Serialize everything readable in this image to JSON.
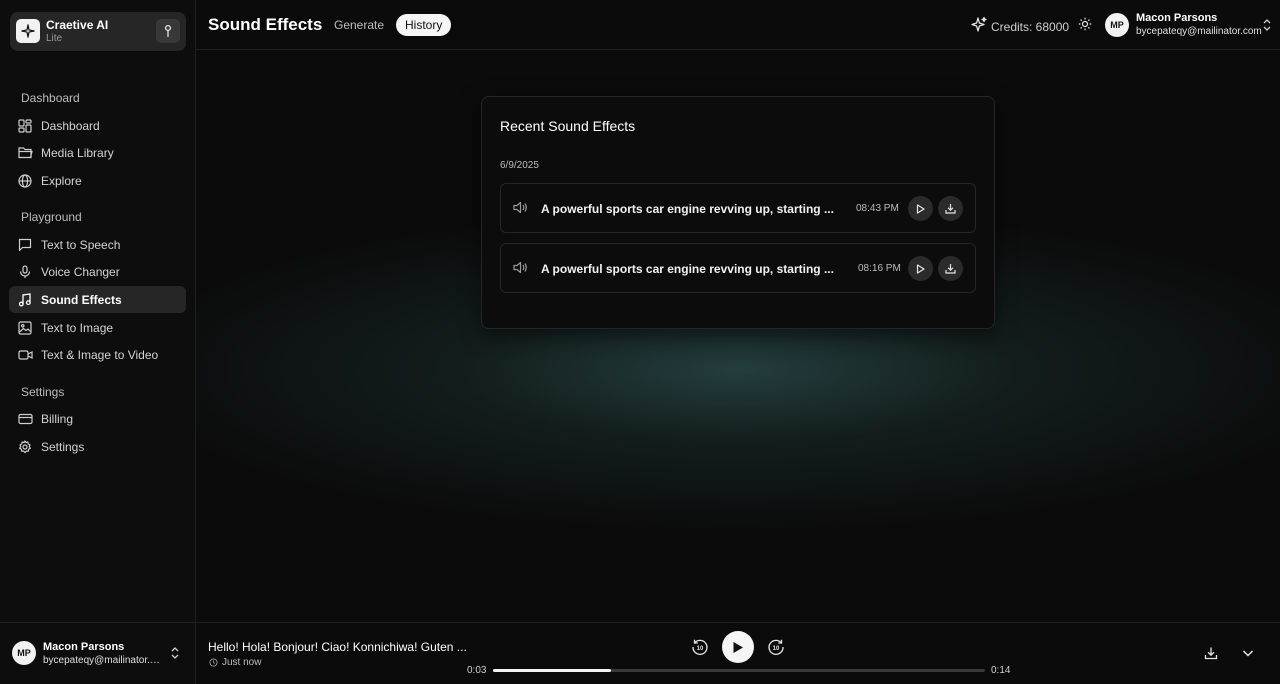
{
  "brand": {
    "name": "Craetive AI",
    "plan": "Lite"
  },
  "sidebar": {
    "sections": [
      {
        "title": "Dashboard"
      },
      {
        "title": "Playground"
      },
      {
        "title": "Settings"
      }
    ],
    "items": [
      {
        "label": "Dashboard",
        "icon": "dashboard-grid-icon"
      },
      {
        "label": "Media Library",
        "icon": "folder-icon"
      },
      {
        "label": "Explore",
        "icon": "globe-icon"
      },
      {
        "label": "Text to Speech",
        "icon": "message-square-icon"
      },
      {
        "label": "Voice Changer",
        "icon": "microphone-icon"
      },
      {
        "label": "Sound Effects",
        "icon": "music-note-icon",
        "active": true
      },
      {
        "label": "Text to Image",
        "icon": "image-icon"
      },
      {
        "label": "Text & Image to Video",
        "icon": "video-camera-icon"
      },
      {
        "label": "Billing",
        "icon": "credit-card-icon"
      },
      {
        "label": "Settings",
        "icon": "gear-icon"
      }
    ]
  },
  "user": {
    "initials": "MP",
    "name": "Macon Parsons",
    "email": "bycepateqy@mailinator.com",
    "email_truncated": "bycepateqy@mailinator.c..."
  },
  "header": {
    "title": "Sound Effects",
    "tabs": [
      {
        "label": "Generate",
        "active": false
      },
      {
        "label": "History",
        "active": true
      }
    ],
    "credits_label": "Credits: 68000"
  },
  "history": {
    "title": "Recent Sound Effects",
    "date": "6/9/2025",
    "items": [
      {
        "text": "A powerful sports car engine revving up, starting ...",
        "time": "08:43 PM"
      },
      {
        "text": "A powerful sports car engine revving up, starting ...",
        "time": "08:16 PM"
      }
    ]
  },
  "player": {
    "title": "Hello! Hola! Bonjour! Ciao! Konnichiwa! Guten ...",
    "subtitle": "Just now",
    "current": "0:03",
    "duration": "0:14",
    "progress": 0.24
  },
  "colors": {
    "background": "#0b0b0b",
    "accent": "#f5f5f5",
    "glow": "#2c4e4e"
  }
}
